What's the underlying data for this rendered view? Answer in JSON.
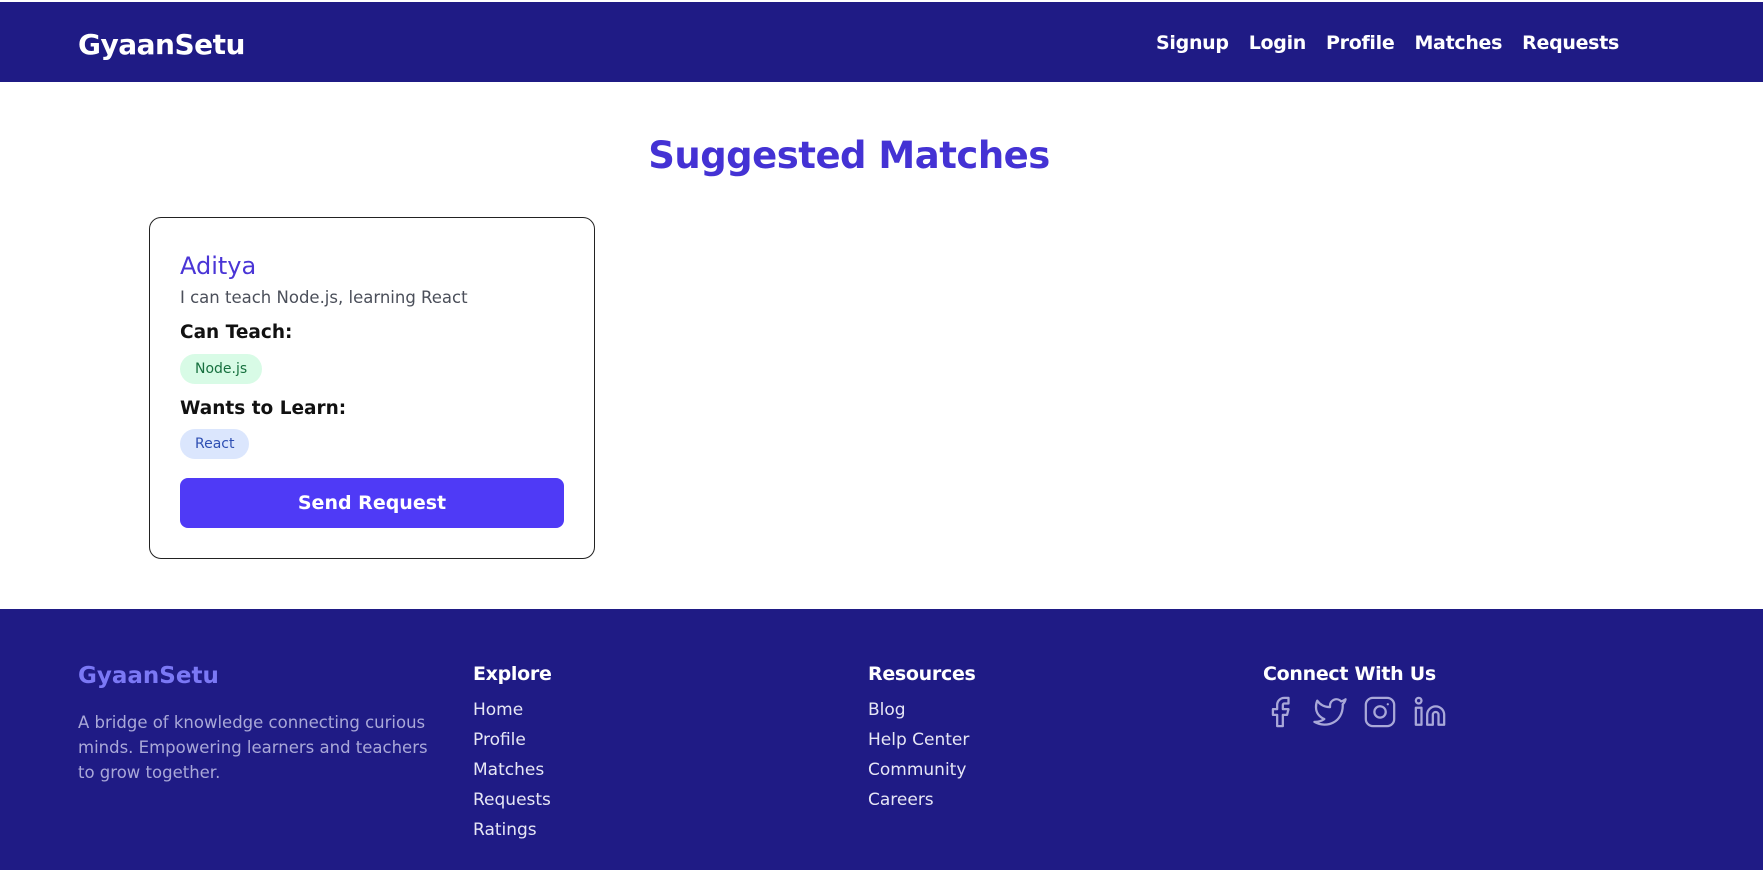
{
  "header": {
    "brand": "GyaanSetu",
    "nav": [
      "Signup",
      "Login",
      "Profile",
      "Matches",
      "Requests"
    ]
  },
  "main": {
    "title": "Suggested Matches",
    "cards": [
      {
        "name": "Aditya",
        "bio": "I can teach Node.js, learning React",
        "teach_label": "Can Teach:",
        "teach_tags": [
          "Node.js"
        ],
        "learn_label": "Wants to Learn:",
        "learn_tags": [
          "React"
        ],
        "button_label": "Send Request"
      }
    ]
  },
  "footer": {
    "brand": "GyaanSetu",
    "description": "A bridge of knowledge connecting curious minds. Empowering learners and teachers to grow together.",
    "explore": {
      "heading": "Explore",
      "links": [
        "Home",
        "Profile",
        "Matches",
        "Requests",
        "Ratings"
      ]
    },
    "resources": {
      "heading": "Resources",
      "links": [
        "Blog",
        "Help Center",
        "Community",
        "Careers"
      ]
    },
    "connect": {
      "heading": "Connect With Us",
      "icons": [
        "facebook-icon",
        "twitter-icon",
        "instagram-icon",
        "linkedin-icon"
      ]
    }
  },
  "colors": {
    "navy": "#1f1b85",
    "accent": "#4432d4",
    "button": "#4f3af6",
    "teach_tag_bg": "#d8fbe6",
    "learn_tag_bg": "#dbe6fd"
  }
}
